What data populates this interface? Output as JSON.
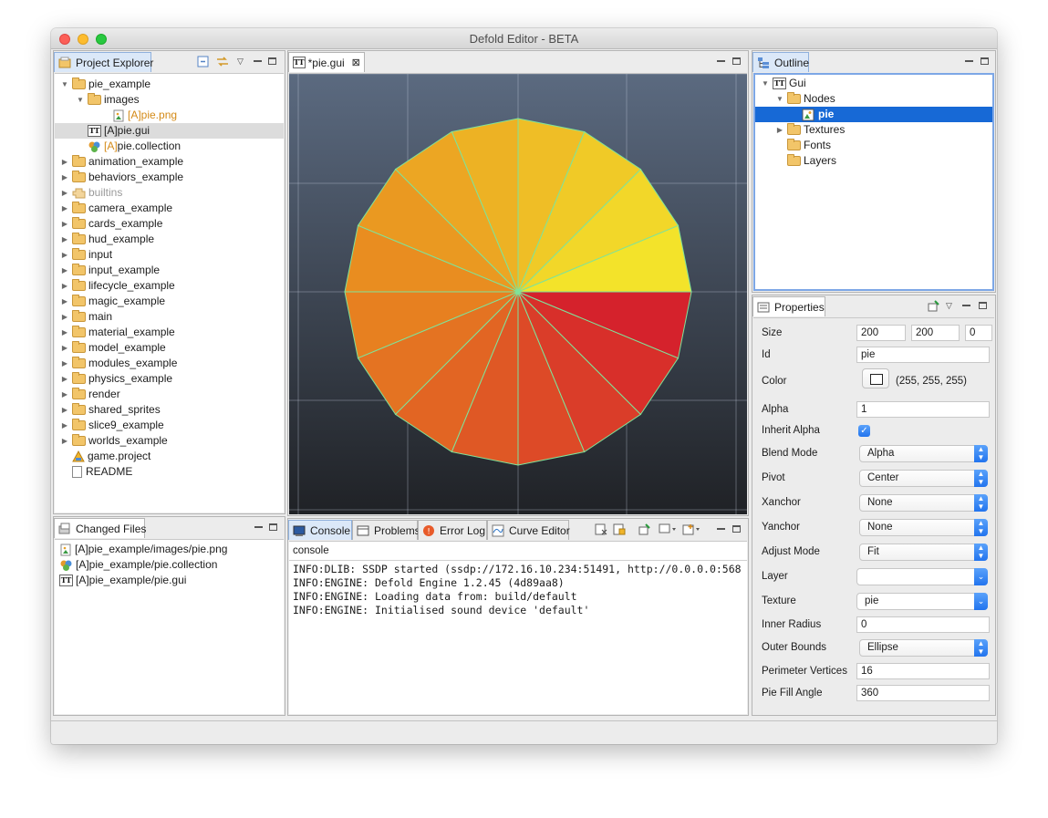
{
  "window": {
    "title": "Defold Editor - BETA"
  },
  "project_explorer": {
    "tab_label": "Project Explorer",
    "items": [
      {
        "label": "pie_example",
        "prefix": "",
        "kind": "folder",
        "expanded": true,
        "indent": 0
      },
      {
        "label": "images",
        "prefix": "",
        "kind": "folder",
        "expanded": true,
        "indent": 1
      },
      {
        "label": "pie.png",
        "prefix": "[A]",
        "kind": "image",
        "indent": 2
      },
      {
        "label": "pie.gui",
        "prefix": "[A]",
        "kind": "gui",
        "indent": 1,
        "selected": true
      },
      {
        "label": "pie.collection",
        "prefix": "[A]",
        "kind": "collection",
        "indent": 1
      },
      {
        "label": "animation_example",
        "kind": "folder",
        "indent": 0
      },
      {
        "label": "behaviors_example",
        "kind": "folder",
        "indent": 0
      },
      {
        "label": "builtins",
        "kind": "builtins",
        "indent": 0
      },
      {
        "label": "camera_example",
        "kind": "folder",
        "indent": 0
      },
      {
        "label": "cards_example",
        "kind": "folder",
        "indent": 0
      },
      {
        "label": "hud_example",
        "kind": "folder",
        "indent": 0
      },
      {
        "label": "input",
        "kind": "folder",
        "indent": 0
      },
      {
        "label": "input_example",
        "kind": "folder",
        "indent": 0
      },
      {
        "label": "lifecycle_example",
        "kind": "folder",
        "indent": 0
      },
      {
        "label": "magic_example",
        "kind": "folder",
        "indent": 0
      },
      {
        "label": "main",
        "kind": "folder",
        "indent": 0
      },
      {
        "label": "material_example",
        "kind": "folder",
        "indent": 0
      },
      {
        "label": "model_example",
        "kind": "folder",
        "indent": 0
      },
      {
        "label": "modules_example",
        "kind": "folder",
        "indent": 0
      },
      {
        "label": "physics_example",
        "kind": "folder",
        "indent": 0
      },
      {
        "label": "render",
        "kind": "folder",
        "indent": 0
      },
      {
        "label": "shared_sprites",
        "kind": "folder",
        "indent": 0
      },
      {
        "label": "slice9_example",
        "kind": "folder",
        "indent": 0
      },
      {
        "label": "worlds_example",
        "kind": "folder",
        "indent": 0
      },
      {
        "label": "game.project",
        "kind": "project",
        "indent": 0
      },
      {
        "label": "README",
        "kind": "file",
        "indent": 0
      }
    ]
  },
  "changed_files": {
    "tab_label": "Changed Files",
    "items": [
      {
        "label": "[A]pie_example/images/pie.png",
        "kind": "image"
      },
      {
        "label": "[A]pie_example/pie.collection",
        "kind": "collection"
      },
      {
        "label": "[A]pie_example/pie.gui",
        "kind": "gui"
      }
    ]
  },
  "editor": {
    "tab_label": "*pie.gui",
    "pie": {
      "perimeter_vertices": 16,
      "fill_angle": 360,
      "colors": [
        "#f3e32a",
        "#e8871f",
        "#d5222c"
      ]
    }
  },
  "console": {
    "tabs": [
      "Console",
      "Problems",
      "Error Log",
      "Curve Editor"
    ],
    "header": "console",
    "lines": [
      "INFO:DLIB: SSDP started (ssdp://172.16.10.234:51491, http://0.0.0.0:568",
      "INFO:ENGINE: Defold Engine 1.2.45 (4d89aa8)",
      "INFO:ENGINE: Loading data from: build/default",
      "INFO:ENGINE: Initialised sound device 'default'"
    ]
  },
  "outline": {
    "tab_label": "Outline",
    "items": [
      {
        "label": "Gui",
        "kind": "gui",
        "expanded": true,
        "indent": 0
      },
      {
        "label": "Nodes",
        "kind": "folder",
        "expanded": true,
        "indent": 1
      },
      {
        "label": "pie",
        "kind": "node",
        "indent": 2,
        "selected": true
      },
      {
        "label": "Textures",
        "kind": "folder",
        "collapsed": true,
        "indent": 1
      },
      {
        "label": "Fonts",
        "kind": "folder",
        "indent": 1
      },
      {
        "label": "Layers",
        "kind": "folder",
        "indent": 1
      }
    ]
  },
  "properties": {
    "tab_label": "Properties",
    "size": {
      "label": "Size",
      "x": "200",
      "y": "200",
      "z": "0"
    },
    "id": {
      "label": "Id",
      "value": "pie"
    },
    "color": {
      "label": "Color",
      "value": "(255, 255, 255)",
      "swatch": "#ffffff"
    },
    "alpha": {
      "label": "Alpha",
      "value": "1"
    },
    "inherit_alpha": {
      "label": "Inherit Alpha",
      "checked": true
    },
    "blend_mode": {
      "label": "Blend Mode",
      "value": "Alpha"
    },
    "pivot": {
      "label": "Pivot",
      "value": "Center"
    },
    "xanchor": {
      "label": "Xanchor",
      "value": "None"
    },
    "yanchor": {
      "label": "Yanchor",
      "value": "None"
    },
    "adjust_mode": {
      "label": "Adjust Mode",
      "value": "Fit"
    },
    "layer": {
      "label": "Layer",
      "value": ""
    },
    "texture": {
      "label": "Texture",
      "value": "pie"
    },
    "inner_radius": {
      "label": "Inner Radius",
      "value": "0"
    },
    "outer_bounds": {
      "label": "Outer Bounds",
      "value": "Ellipse"
    },
    "perimeter_vertices": {
      "label": "Perimeter Vertices",
      "value": "16"
    },
    "pie_fill_angle": {
      "label": "Pie Fill Angle",
      "value": "360"
    }
  },
  "colors": {
    "selection": "#1769d6",
    "accent": "#2b7cf0",
    "canvas_top": "#5b6a80",
    "canvas_bottom": "#1f2125"
  }
}
